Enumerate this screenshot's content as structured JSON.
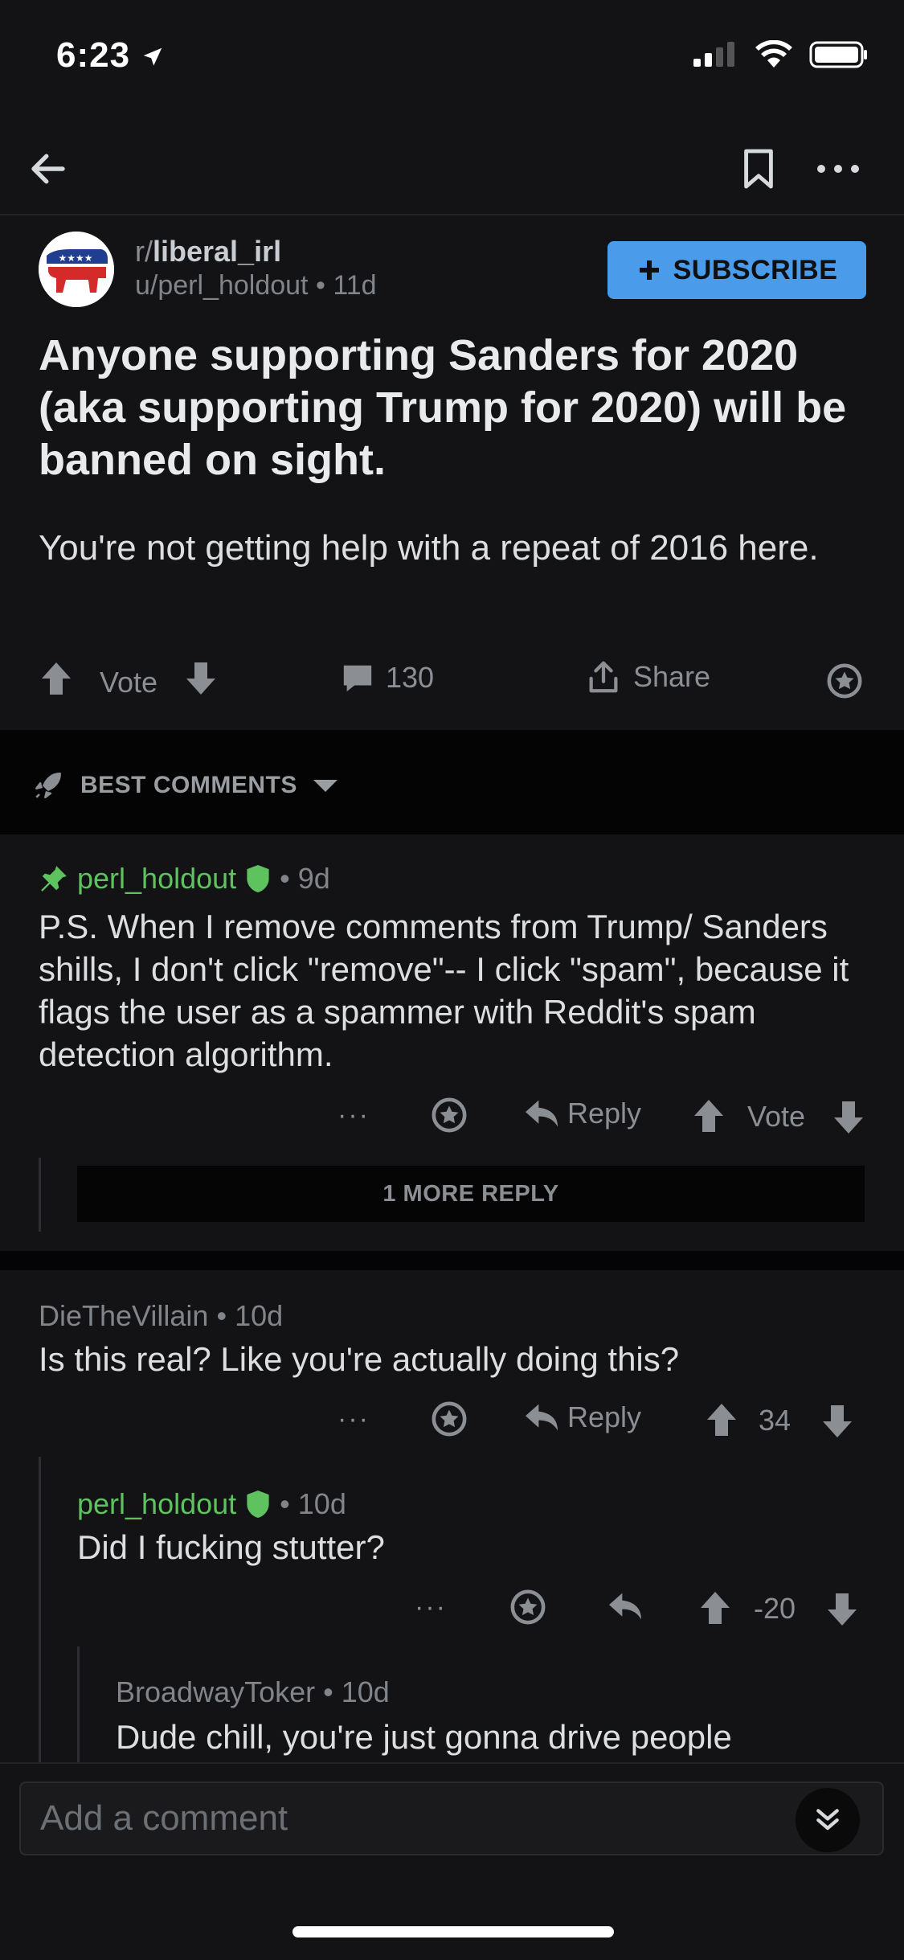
{
  "status_bar": {
    "time": "6:23"
  },
  "post": {
    "subreddit_prefix": "r/",
    "subreddit": "liberal_irl",
    "author": "u/perl_holdout",
    "age": "11d",
    "subscribe_label": "SUBSCRIBE",
    "title": "Anyone supporting Sanders for 2020 (aka supporting Trump for 2020) will be banned on sight.",
    "body": "You're not getting help with a repeat of 2016 here.",
    "vote_label": "Vote",
    "comment_count": "130",
    "share_label": "Share"
  },
  "sort": {
    "label": "BEST COMMENTS"
  },
  "comments": [
    {
      "author": "perl_holdout",
      "age": "9d",
      "text": "P.S. When I remove comments from Trump/ Sanders shills, I don't click \"remove\"-- I click \"spam\", because it flags the user as a spammer with Reddit's spam detection algorithm.",
      "reply_label": "Reply",
      "vote_label": "Vote",
      "more_replies": "1 MORE REPLY"
    },
    {
      "author": "DieTheVillain",
      "age": "10d",
      "text": "Is this real? Like you're actually doing this?",
      "reply_label": "Reply",
      "score": "34"
    },
    {
      "author": "perl_holdout",
      "age": "10d",
      "text": "Did I fucking stutter?",
      "score": "-20"
    },
    {
      "author": "BroadwayToker",
      "age": "10d",
      "text": "Dude chill, you're just gonna drive people"
    }
  ],
  "composer": {
    "placeholder": "Add a comment"
  },
  "colors": {
    "accent": "#4a9be9",
    "mod_green": "#5ec25f",
    "background": "#131316"
  },
  "icons": [
    "back-arrow-icon",
    "bookmark-icon",
    "more-icon",
    "upvote-icon",
    "downvote-icon",
    "comment-icon",
    "share-icon",
    "award-icon",
    "rocket-icon",
    "pin-icon",
    "shield-icon",
    "reply-icon",
    "chevron-double-down-icon"
  ]
}
